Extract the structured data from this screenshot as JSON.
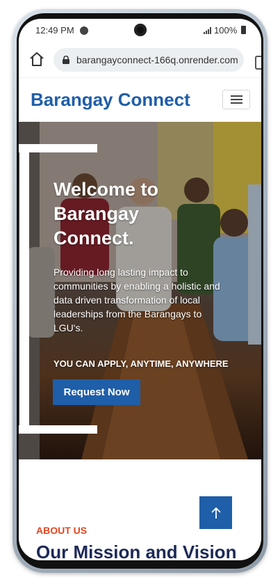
{
  "status_bar": {
    "time": "12:49 PM",
    "battery": "100%",
    "icons": [
      "spotify-icon",
      "camera-punch-hole",
      "signal-icon",
      "battery-icon"
    ]
  },
  "browser": {
    "url": "barangayconnect-166q.onrender.com",
    "icons": [
      "home-icon",
      "lock-icon",
      "tabs-icon"
    ]
  },
  "site": {
    "brand": "Barangay Connect",
    "menu_icon": "hamburger-menu-icon",
    "brand_color": "#1f5ea8"
  },
  "hero": {
    "title": "Welcome to Barangay Connect.",
    "description": "Providing long lasting impact to communities by enabling a holistic and data driven transformation of local leaderships from the Barangays to LGU's.",
    "cta_text": "YOU CAN APPLY, ANYTIME, ANYWHERE",
    "button_label": "Request Now"
  },
  "about": {
    "label": "ABOUT US",
    "title": "Our Mission and Vision",
    "label_color": "#e4451f",
    "title_color": "#1d2a57"
  },
  "scroll_top_icon": "arrow-up-icon"
}
